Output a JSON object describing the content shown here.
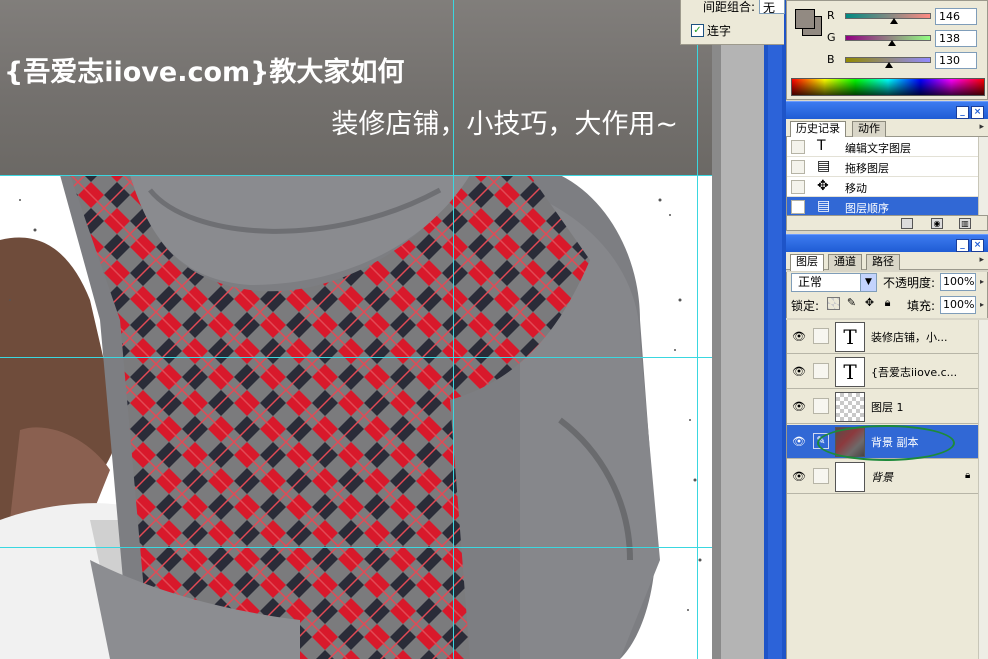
{
  "canvas": {
    "title_line1": "{吾爱志iiove.com}教大家如何",
    "title_line2": "装修店铺，小技巧，大作用~"
  },
  "character_panel": {
    "spacing_label": "间距组合:",
    "spacing_value": "无",
    "ligature_label": "连字",
    "ligature_checked": true
  },
  "color_panel": {
    "foreground_color": "#928a82",
    "channels": [
      {
        "label": "R",
        "value": "146",
        "fraction": 0.573
      },
      {
        "label": "G",
        "value": "138",
        "fraction": 0.541
      },
      {
        "label": "B",
        "value": "130",
        "fraction": 0.51
      }
    ]
  },
  "history_panel": {
    "tabs": [
      "历史记录",
      "动作"
    ],
    "active_tab": "历史记录",
    "items": [
      {
        "icon": "text-icon",
        "label": "编辑文字图层",
        "selected": false
      },
      {
        "icon": "drag-layer-icon",
        "label": "拖移图层",
        "selected": false
      },
      {
        "icon": "move-icon",
        "label": "移动",
        "selected": false
      },
      {
        "icon": "layer-order-icon",
        "label": "图层顺序",
        "selected": true
      }
    ]
  },
  "layers_panel": {
    "tabs": [
      "图层",
      "通道",
      "路径"
    ],
    "active_tab": "图层",
    "blend_mode": "正常",
    "opacity_label": "不透明度:",
    "opacity_value": "100%",
    "lock_label": "锁定:",
    "fill_label": "填充:",
    "fill_value": "100%",
    "layers": [
      {
        "name": "装修店铺，小...",
        "type": "text",
        "visible": true,
        "selected": false,
        "locked": false
      },
      {
        "name": "{吾爱志iiove.c...",
        "type": "text",
        "visible": true,
        "selected": false,
        "locked": false
      },
      {
        "name": "图层 1",
        "type": "transparent",
        "visible": true,
        "selected": false,
        "locked": false
      },
      {
        "name": "背景 副本",
        "type": "photo",
        "visible": true,
        "selected": true,
        "locked": false
      },
      {
        "name": "背景",
        "type": "white",
        "visible": true,
        "selected": false,
        "locked": true
      }
    ]
  },
  "colors": {
    "guide": "#3ad7e0",
    "selection": "#3168d5",
    "annotation_ellipse": "#1d8a3a"
  }
}
